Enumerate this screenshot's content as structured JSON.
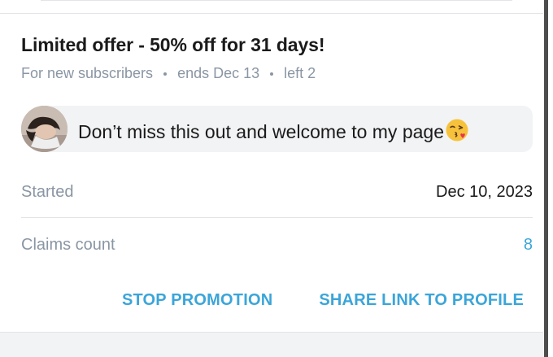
{
  "promotion": {
    "title": "Limited offer - 50% off for 31 days!",
    "audience": "For new subscribers",
    "ends": "ends Dec 13",
    "left": "left 2",
    "message": "Don’t miss this out and welcome to my page",
    "message_emoji": "kissing-face-emoji"
  },
  "details": {
    "started_label": "Started",
    "started_value": "Dec 10, 2023",
    "claims_label": "Claims count",
    "claims_value": "8"
  },
  "actions": {
    "stop_label": "STOP PROMOTION",
    "share_label": "SHARE LINK TO PROFILE"
  },
  "colors": {
    "accent": "#3ba5d9",
    "muted": "#8a96a3",
    "text": "#1a1a1a",
    "bubble": "#f2f3f5"
  }
}
